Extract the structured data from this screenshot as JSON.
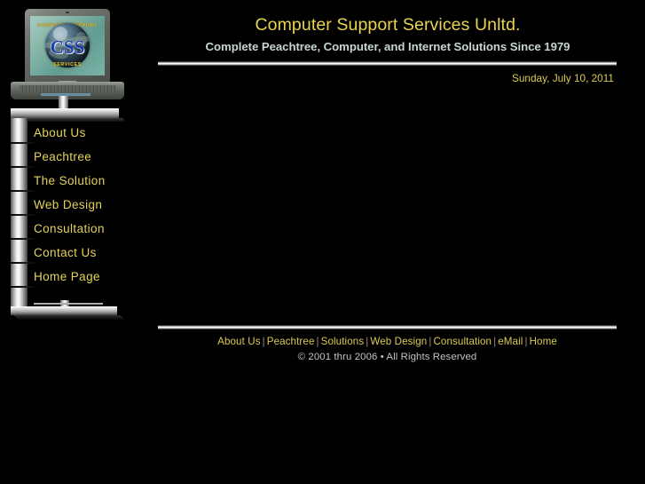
{
  "header": {
    "title": "Computer Support Services Unltd.",
    "tagline": "Complete Peachtree, Computer, and Internet Solutions Since 1979",
    "date": "Sunday, July 10, 2011"
  },
  "logo": {
    "alt": "Computer Support Services laptop logo",
    "monogram": "CSS",
    "arc_top": "COMPUTER SUPPORT",
    "arc_bottom": "SERVICES"
  },
  "sidebar": {
    "items": [
      {
        "label": "About Us"
      },
      {
        "label": "Peachtree"
      },
      {
        "label": "The Solution"
      },
      {
        "label": "Web Design"
      },
      {
        "label": "Consultation"
      },
      {
        "label": "Contact Us"
      },
      {
        "label": "Home Page"
      }
    ]
  },
  "footer": {
    "links": [
      {
        "label": "About Us"
      },
      {
        "label": "Peachtree"
      },
      {
        "label": "Solutions"
      },
      {
        "label": "Web Design"
      },
      {
        "label": "Consultation"
      },
      {
        "label": "eMail"
      },
      {
        "label": "Home"
      }
    ],
    "separator": "|",
    "copyright": "© 2001 thru 2006  •  All Rights Reserved"
  },
  "colors": {
    "background": "#000000",
    "accent_gold": "#e4d35a",
    "title_gold": "#e9d451",
    "tagline": "#c6d6d4",
    "copyright": "#c3c3c3",
    "metal_light": "#ffffff",
    "metal_dark": "#3c3c3c"
  }
}
